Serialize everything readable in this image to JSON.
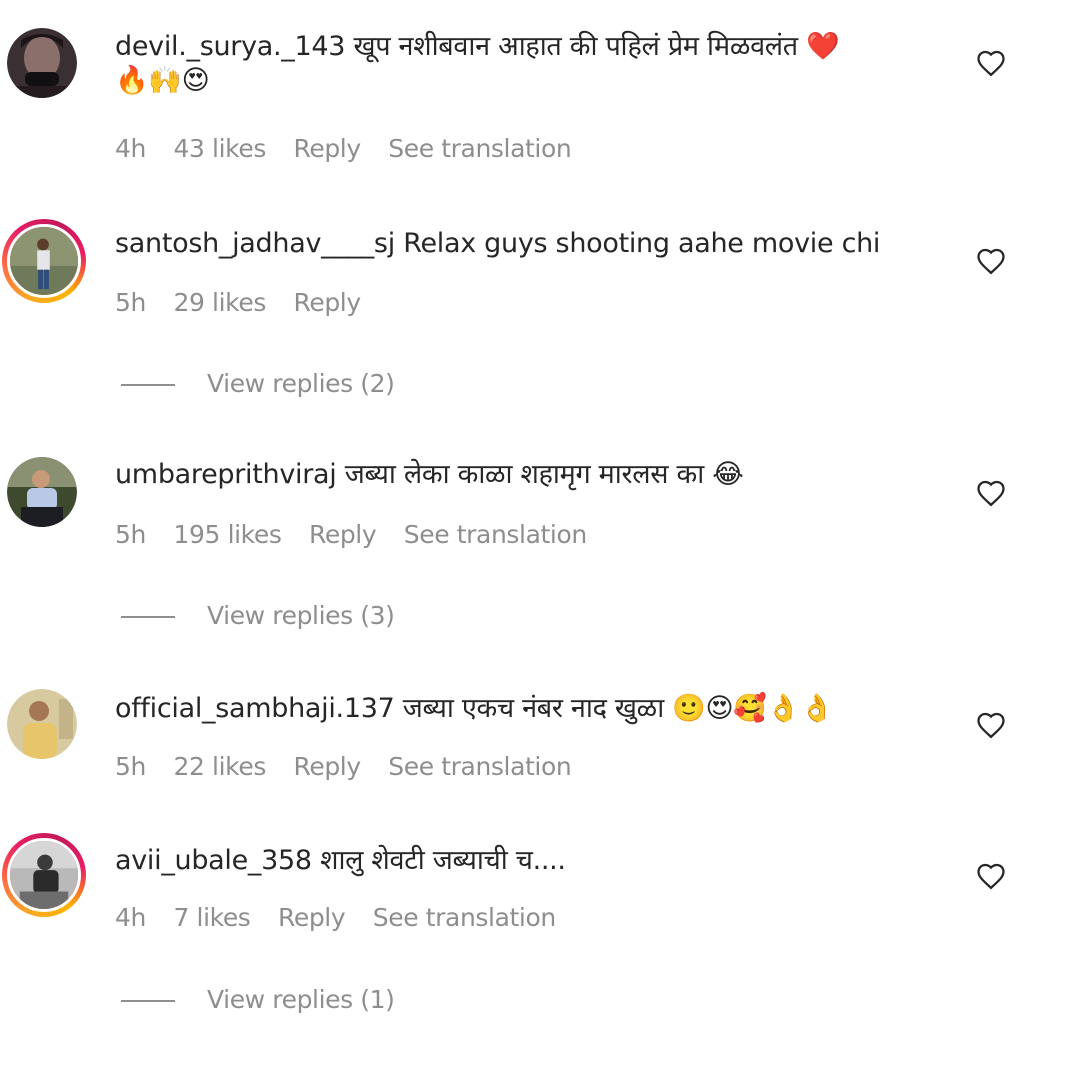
{
  "comments": [
    {
      "username": "devil._surya._143",
      "text": "खूप नशीबवान आहात की पहिलं प्रेम मिळवलंत ❤️",
      "emojis": "🔥🙌😍",
      "time": "4h",
      "likes": "43 likes",
      "reply": "Reply",
      "translate": "See translation"
    },
    {
      "username": "santosh_jadhav____sj",
      "text": "Relax guys shooting aahe movie chi",
      "time": "5h",
      "likes": "29 likes",
      "reply": "Reply",
      "view_replies": "View replies (2)"
    },
    {
      "username": "umbareprithviraj",
      "text": "जब्या लेका काळा शहामृग मारलस का 😂",
      "time": "5h",
      "likes": "195 likes",
      "reply": "Reply",
      "translate": "See translation",
      "view_replies": "View replies (3)"
    },
    {
      "username": "official_sambhaji.137",
      "text": "जब्या एकच नंबर नाद खुळा 🙂😍🥰👌👌",
      "time": "5h",
      "likes": "22 likes",
      "reply": "Reply",
      "translate": "See translation"
    },
    {
      "username": "avii_ubale_358",
      "text": "शालु शेवटी जब्याची च....",
      "time": "4h",
      "likes": "7 likes",
      "reply": "Reply",
      "translate": "See translation",
      "view_replies": "View replies (1)"
    }
  ],
  "icons": {
    "like": "heart-outline-icon",
    "divider": "horizontal-line"
  },
  "colors": {
    "text": "#262626",
    "secondary": "#8e8e8e",
    "story_ring": "#e91e63"
  }
}
